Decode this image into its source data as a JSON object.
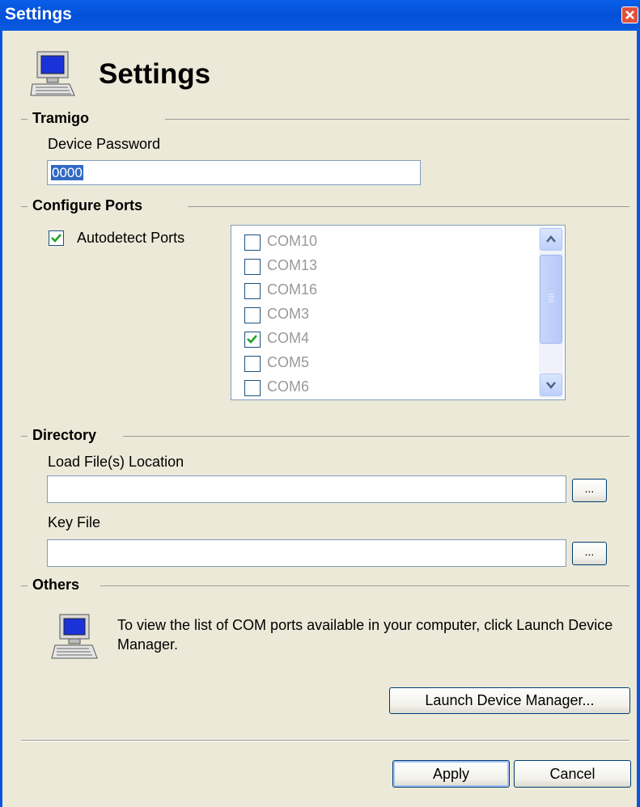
{
  "window": {
    "title": "Settings"
  },
  "header": {
    "title": "Settings",
    "icon": "computer-icon"
  },
  "tramigo": {
    "group_label": "Tramigo",
    "password_label": "Device Password",
    "password_value": "0000"
  },
  "ports": {
    "group_label": "Configure Ports",
    "autodetect_label": "Autodetect Ports",
    "autodetect_checked": true,
    "items": [
      {
        "label": "COM10",
        "checked": false
      },
      {
        "label": "COM13",
        "checked": false
      },
      {
        "label": "COM16",
        "checked": false
      },
      {
        "label": "COM3",
        "checked": false
      },
      {
        "label": "COM4",
        "checked": true
      },
      {
        "label": "COM5",
        "checked": false
      },
      {
        "label": "COM6",
        "checked": false
      }
    ]
  },
  "directory": {
    "group_label": "Directory",
    "load_label": "Load File(s) Location",
    "load_value": "",
    "key_label": "Key File",
    "key_value": "",
    "browse_label": "..."
  },
  "others": {
    "group_label": "Others",
    "info_text": "To view the list of COM ports available in your computer, click Launch Device Manager.",
    "launch_button": "Launch Device Manager..."
  },
  "footer": {
    "apply_label": "Apply",
    "cancel_label": "Cancel"
  },
  "colors": {
    "titlebar": "#0a5fe8",
    "window_bg": "#ece9d8",
    "selection": "#316ac5",
    "check": "#21a121"
  }
}
